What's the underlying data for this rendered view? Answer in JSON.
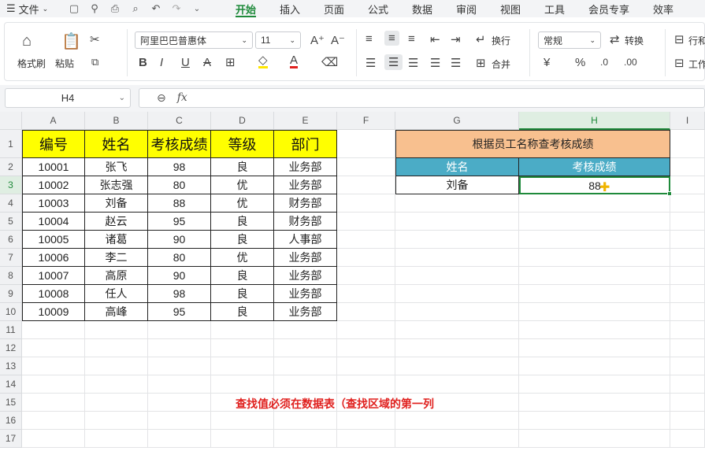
{
  "menubar": {
    "file_label": "文件",
    "tabs": [
      "开始",
      "插入",
      "页面",
      "公式",
      "数据",
      "审阅",
      "视图",
      "工具",
      "会员专享",
      "效率"
    ],
    "active_tab": "开始"
  },
  "ribbon": {
    "format_painter": "格式刷",
    "paste": "粘贴",
    "font_name": "阿里巴巴普惠体",
    "font_size": "11",
    "wrap": "换行",
    "merge": "合并",
    "number_format": "常规",
    "convert": "转换",
    "row_col": "行和",
    "worksheet": "工作"
  },
  "formula": {
    "name_box": "H4",
    "fx": "fx",
    "value": ""
  },
  "columns": [
    "A",
    "B",
    "C",
    "D",
    "E",
    "F",
    "G",
    "H",
    "I"
  ],
  "rows": [
    "1",
    "2",
    "3",
    "4",
    "5",
    "6",
    "7",
    "8",
    "9",
    "10",
    "11",
    "12",
    "13",
    "14",
    "15",
    "16",
    "17"
  ],
  "table": {
    "headers": [
      "编号",
      "姓名",
      "考核成绩",
      "等级",
      "部门"
    ],
    "rows": [
      [
        "10001",
        "张飞",
        "98",
        "良",
        "业务部"
      ],
      [
        "10002",
        "张志强",
        "80",
        "优",
        "业务部"
      ],
      [
        "10003",
        "刘备",
        "88",
        "优",
        "财务部"
      ],
      [
        "10004",
        "赵云",
        "95",
        "良",
        "财务部"
      ],
      [
        "10005",
        "诸葛",
        "90",
        "良",
        "人事部"
      ],
      [
        "10006",
        "李二",
        "80",
        "优",
        "业务部"
      ],
      [
        "10007",
        "高原",
        "90",
        "良",
        "业务部"
      ],
      [
        "10008",
        "任人",
        "98",
        "良",
        "业务部"
      ],
      [
        "10009",
        "高峰",
        "95",
        "良",
        "业务部"
      ]
    ]
  },
  "lookup": {
    "title": "根据员工名称查考核成绩",
    "col1": "姓名",
    "col2": "考核成绩",
    "name": "刘备",
    "score": "88"
  },
  "note": "查找值必须在数据表（查找区域的第一列",
  "colors": {
    "accent": "#1f8a3b",
    "header_yellow": "#ffff00",
    "title_orange": "#f8c08f",
    "lookup_blue": "#4bacc6",
    "note_red": "#e0211f"
  }
}
